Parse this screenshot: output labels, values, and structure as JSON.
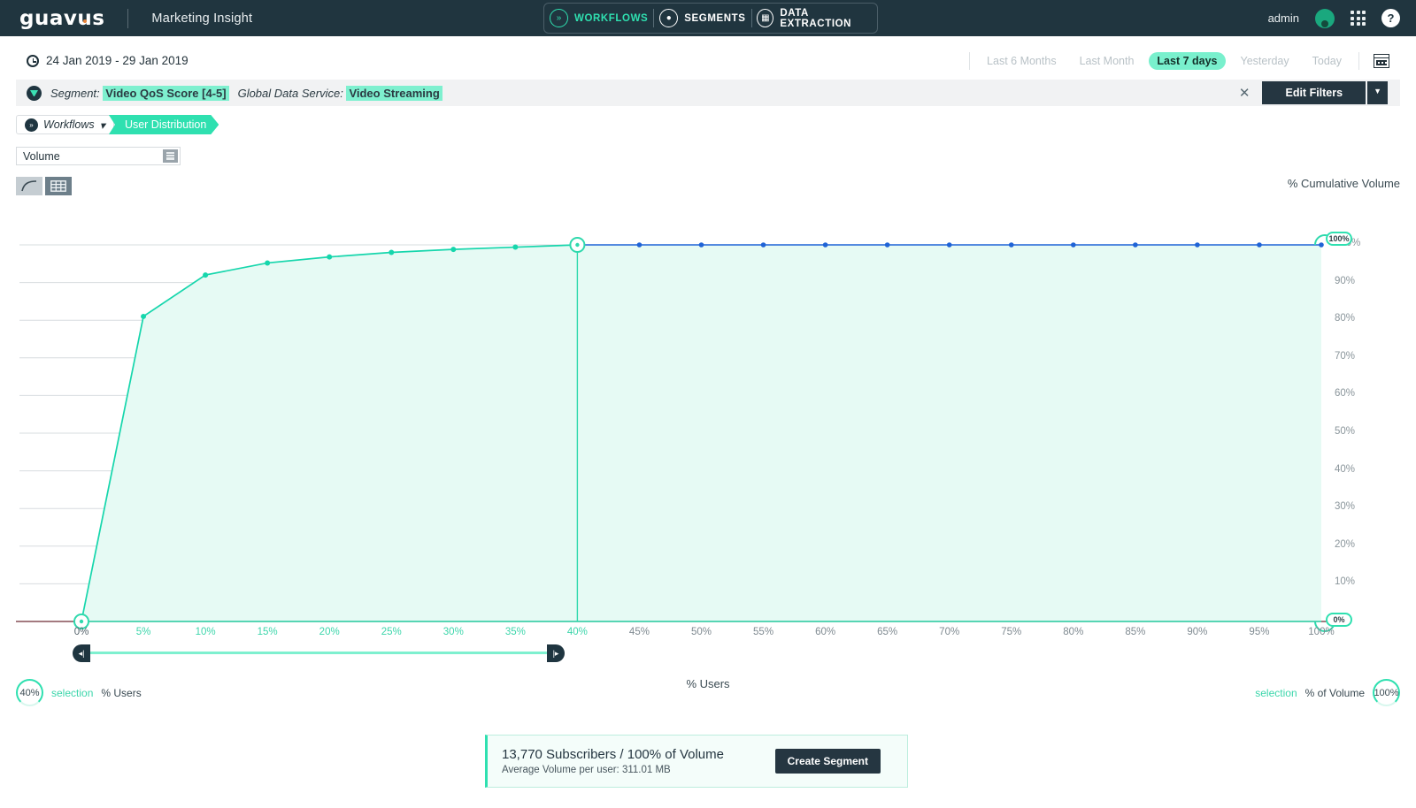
{
  "header": {
    "logo": "guavus",
    "app_title": "Marketing Insight",
    "nav": [
      {
        "label": "WORKFLOWS",
        "icon": "workflows-icon",
        "active": true
      },
      {
        "label": "SEGMENTS",
        "icon": "segments-icon",
        "active": false
      },
      {
        "label": "DATA EXTRACTION",
        "icon": "data-extraction-icon",
        "active": false
      }
    ],
    "user": "admin",
    "apps_icon": "grid-apps-icon",
    "help_icon": "help-icon"
  },
  "datebar": {
    "clock_icon": "clock-icon",
    "range_text": "24 Jan 2019 - 29 Jan 2019",
    "presets": [
      {
        "label": "Last 6 Months",
        "active": false
      },
      {
        "label": "Last Month",
        "active": false
      },
      {
        "label": "Last 7 days",
        "active": true
      },
      {
        "label": "Yesterday",
        "active": false
      },
      {
        "label": "Today",
        "active": false
      }
    ],
    "calendar_icon": "calendar-icon"
  },
  "filterbar": {
    "filter_icon": "funnel-icon",
    "filters": [
      {
        "key": "Segment:",
        "value": "Video QoS Score [4-5]"
      },
      {
        "key": "Global Data Service:",
        "value": "Video Streaming"
      }
    ],
    "clear_label": "✕",
    "edit_label": "Edit Filters",
    "caret": "▼"
  },
  "breadcrumb": {
    "workflows_label": "Workflows",
    "workflows_caret": "▾",
    "current": "User Distribution"
  },
  "controls": {
    "metric_value": "Volume",
    "metric_placeholder": "Volume",
    "view_curve": "curve-chart-icon",
    "view_table": "table-view-icon"
  },
  "chart_data": {
    "type": "area",
    "title": "",
    "xlabel": "% Users",
    "ylabel": "% Cumulative Volume",
    "xlim": [
      0,
      100
    ],
    "ylim": [
      0,
      100
    ],
    "grid": true,
    "x_ticks": [
      "0%",
      "5%",
      "10%",
      "15%",
      "20%",
      "25%",
      "30%",
      "35%",
      "40%",
      "45%",
      "50%",
      "55%",
      "60%",
      "65%",
      "70%",
      "75%",
      "80%",
      "85%",
      "90%",
      "95%",
      "100%"
    ],
    "y_ticks": [
      "0%",
      "10%",
      "20%",
      "30%",
      "40%",
      "50%",
      "60%",
      "70%",
      "80%",
      "90%",
      "100%"
    ],
    "series": [
      {
        "name": "% Cumulative Volume (selection)",
        "color": "#16d6ac",
        "x": [
          0,
          5,
          10,
          15,
          20,
          25,
          30,
          35,
          40
        ],
        "values": [
          0,
          81,
          92,
          95.2,
          96.8,
          98.0,
          98.8,
          99.4,
          100
        ]
      },
      {
        "name": "% Cumulative Volume (beyond selection)",
        "color": "#1f63d6",
        "x": [
          40,
          45,
          50,
          55,
          60,
          65,
          70,
          75,
          80,
          85,
          90,
          95,
          100
        ],
        "values": [
          100,
          100,
          100,
          100,
          100,
          100,
          100,
          100,
          100,
          100,
          100,
          100,
          100
        ]
      }
    ],
    "selection": {
      "x_start": "0%",
      "x_end": "40%",
      "y_value": "100%"
    },
    "axis_title_right": "% Cumulative Volume",
    "axis_title_bottom": "% Users"
  },
  "slider": {
    "left_handle": "range-handle-left",
    "right_handle": "range-handle-right",
    "start": "0%",
    "end": "40%"
  },
  "legend": {
    "left_badge": "40%",
    "left_selection": "selection",
    "left_axis": "% Users",
    "right_selection": "selection",
    "right_axis": "% of Volume",
    "right_badge": "100%",
    "center_title": "% Users"
  },
  "chart_badges": {
    "top_right": "100%",
    "bottom_right": "0%"
  },
  "summary": {
    "line1": "13,770 Subscribers / 100% of Volume",
    "line2": "Average Volume per user: 311.01 MB",
    "button": "Create Segment"
  }
}
